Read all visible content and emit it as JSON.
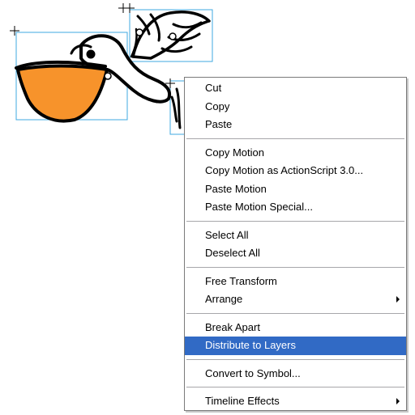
{
  "colors": {
    "selection_box": "#3fa9e0",
    "beak": "#f7932b",
    "menu_highlight": "#316ac5",
    "menu_border": "#7a7a7a",
    "separator": "#a7a6aa"
  },
  "context_menu": {
    "groups": [
      [
        {
          "label": "Cut"
        },
        {
          "label": "Copy"
        },
        {
          "label": "Paste"
        }
      ],
      [
        {
          "label": "Copy Motion"
        },
        {
          "label": "Copy Motion as ActionScript 3.0..."
        },
        {
          "label": "Paste Motion"
        },
        {
          "label": "Paste Motion Special..."
        }
      ],
      [
        {
          "label": "Select All"
        },
        {
          "label": "Deselect All"
        }
      ],
      [
        {
          "label": "Free Transform"
        },
        {
          "label": "Arrange",
          "submenu": true
        }
      ],
      [
        {
          "label": "Break Apart"
        },
        {
          "label": "Distribute to Layers",
          "highlighted": true
        }
      ],
      [
        {
          "label": "Convert to Symbol..."
        }
      ],
      [
        {
          "label": "Timeline Effects",
          "submenu": true
        }
      ]
    ]
  }
}
